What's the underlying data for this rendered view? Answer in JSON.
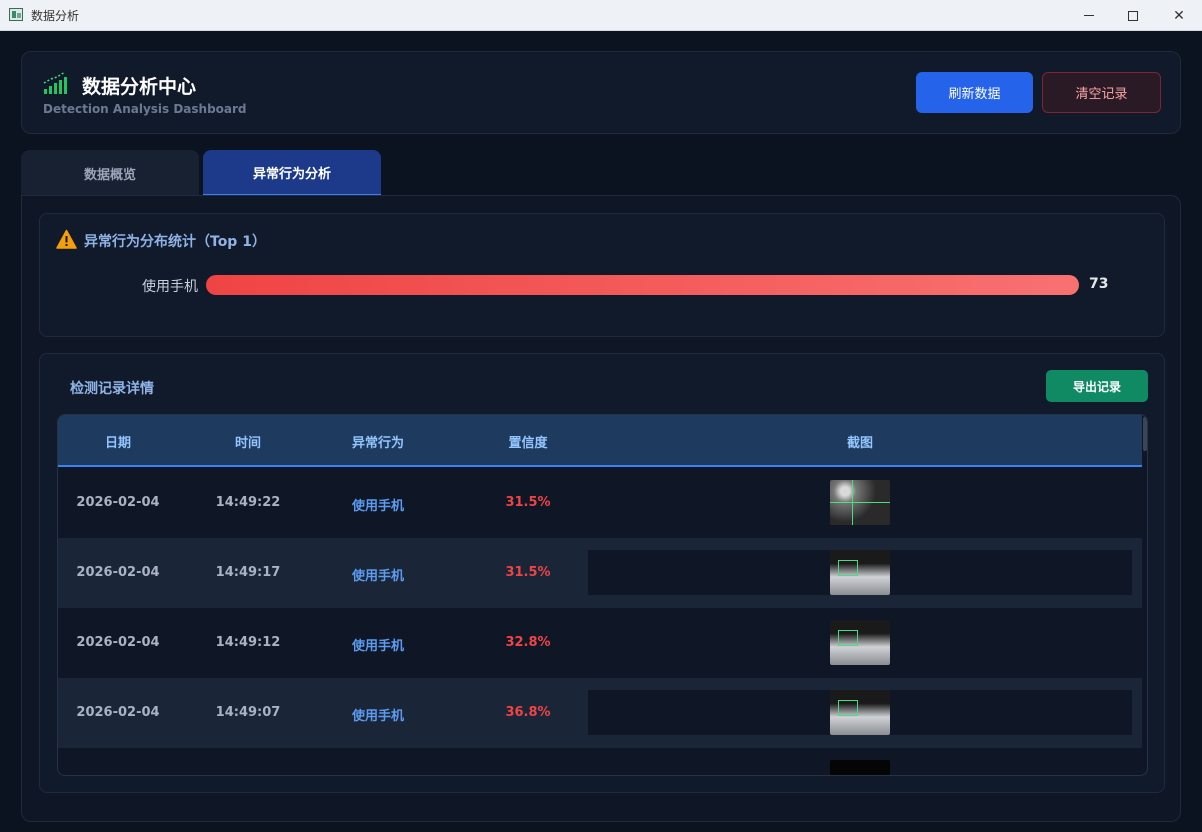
{
  "window": {
    "title": "数据分析"
  },
  "header": {
    "title": "数据分析中心",
    "subtitle": "Detection Analysis Dashboard",
    "refresh_label": "刷新数据",
    "clear_label": "清空记录"
  },
  "tabs": [
    {
      "label": "数据概览",
      "active": false
    },
    {
      "label": "异常行为分析",
      "active": true
    }
  ],
  "stats": {
    "title": "异常行为分布统计（Top 1）",
    "bars": [
      {
        "label": "使用手机",
        "value": "73",
        "fill_fraction": 1.0
      }
    ]
  },
  "records": {
    "title": "检测记录详情",
    "export_label": "导出记录",
    "columns": [
      "日期",
      "时间",
      "异常行为",
      "置信度",
      "截图"
    ],
    "rows": [
      {
        "date": "2026-02-04",
        "time": "14:49:22",
        "behavior": "使用手机",
        "confidence": "31.5%"
      },
      {
        "date": "2026-02-04",
        "time": "14:49:17",
        "behavior": "使用手机",
        "confidence": "31.5%"
      },
      {
        "date": "2026-02-04",
        "time": "14:49:12",
        "behavior": "使用手机",
        "confidence": "32.8%"
      },
      {
        "date": "2026-02-04",
        "time": "14:49:07",
        "behavior": "使用手机",
        "confidence": "36.8%"
      }
    ]
  },
  "colors": {
    "accent": "#2563eb",
    "danger": "#ef4444",
    "success": "#0f8a63"
  }
}
